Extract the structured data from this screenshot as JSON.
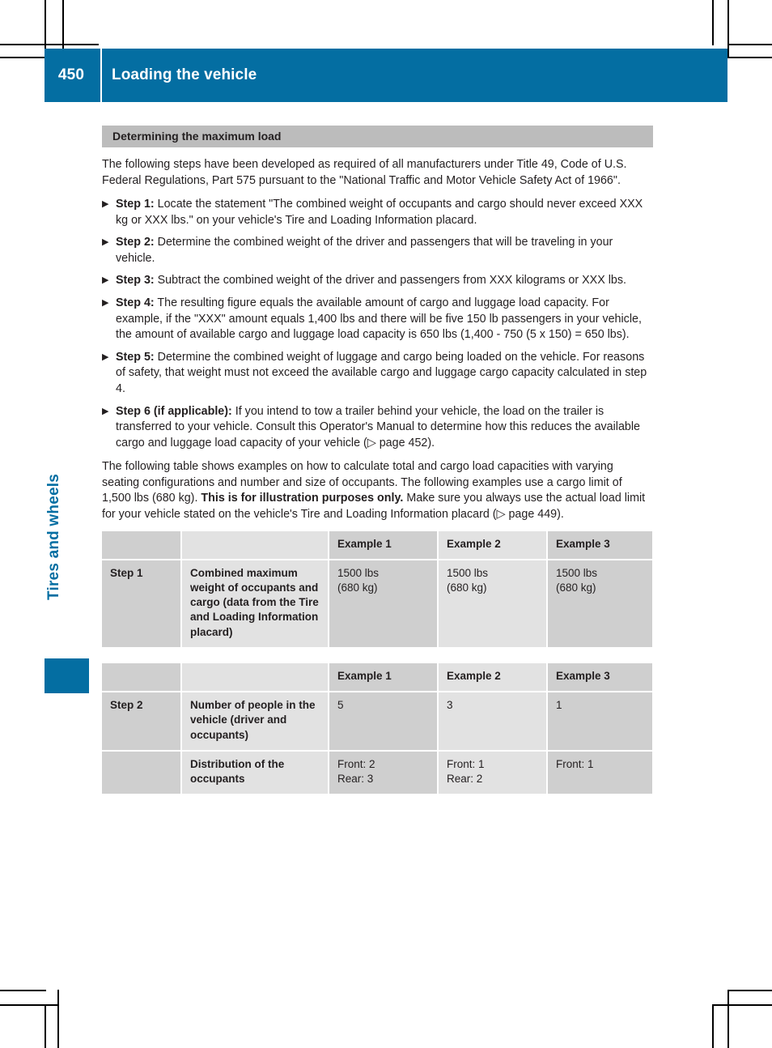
{
  "header": {
    "page_number": "450",
    "title": "Loading the vehicle",
    "accent_color": "#046ea2"
  },
  "chapter_tab": {
    "label": "Tires and wheels",
    "color": "#046ea2"
  },
  "section": {
    "heading": "Determining the maximum load",
    "heading_bg": "#bcbcbc"
  },
  "intro": "The following steps have been developed as required of all manufacturers under Title 49, Code of U.S. Federal Regulations, Part 575 pursuant to the \"National Traffic and Motor Vehicle Safety Act of 1966\".",
  "steps": [
    {
      "bullet": "▶",
      "name": "Step 1:",
      "text": " Locate the statement \"The combined weight of occupants and cargo should never exceed XXX kg or XXX lbs.\" on your vehicle's Tire and Loading Information placard."
    },
    {
      "bullet": "▶",
      "name": "Step 2:",
      "text": " Determine the combined weight of the driver and passengers that will be traveling in your vehicle."
    },
    {
      "bullet": "▶",
      "name": "Step 3:",
      "text": " Subtract the combined weight of the driver and passengers from XXX kilograms or XXX lbs."
    },
    {
      "bullet": "▶",
      "name": "Step 4:",
      "text": " The resulting figure equals the available amount of cargo and luggage load capacity. For example, if the \"XXX\" amount equals 1,400 lbs and there will be five 150 lb passengers in your vehicle, the amount of available cargo and luggage load capacity is 650 lbs (1,400 - 750 (5 x 150) = 650 lbs)."
    },
    {
      "bullet": "▶",
      "name": " Step 5:",
      "text": " Determine the combined weight of luggage and cargo being loaded on the vehicle. For reasons of safety, that weight must not exceed the available cargo and luggage cargo capacity calculated in step 4."
    },
    {
      "bullet": "▶",
      "name": "Step 6 (if applicable):",
      "text": " If you intend to tow a trailer behind your vehicle, the load on the trailer is transferred to your vehicle. Consult this Operator's Manual to determine how this reduces the available cargo and luggage load capacity of your vehicle (▷ page 452)."
    }
  ],
  "outro": {
    "part1": "The following table shows examples on how to calculate total and cargo load capacities with varying seating configurations and number and size of occupants. The following examples use a cargo limit of 1,500 lbs (680 kg). ",
    "emphasis": "This is for illustration purposes only.",
    "part2": " Make sure you always use the actual load limit for your vehicle stated on the vehicle's Tire and Loading Information placard (▷ page 449)."
  },
  "table1": {
    "headers": [
      "",
      "",
      "Example 1",
      "Example 2",
      "Example 3"
    ],
    "rows": [
      {
        "step": "Step 1",
        "description": "Combined maximum weight of occupants and cargo (data from the Tire and Loading Information placard)",
        "example1": "1500 lbs\n(680 kg)",
        "example2": "1500 lbs\n(680 kg)",
        "example3": "1500 lbs\n(680 kg)"
      }
    ]
  },
  "table2": {
    "headers": [
      "",
      "",
      "Example 1",
      "Example 2",
      "Example 3"
    ],
    "rows": [
      {
        "step": "Step 2",
        "description": "Number of people in the vehicle (driver and occupants)",
        "example1": "5",
        "example2": "3",
        "example3": "1"
      },
      {
        "step": "",
        "description": "Distribution of the occupants",
        "example1": "Front: 2\nRear: 3",
        "example2": "Front: 1\nRear: 2",
        "example3": "Front: 1"
      }
    ]
  }
}
